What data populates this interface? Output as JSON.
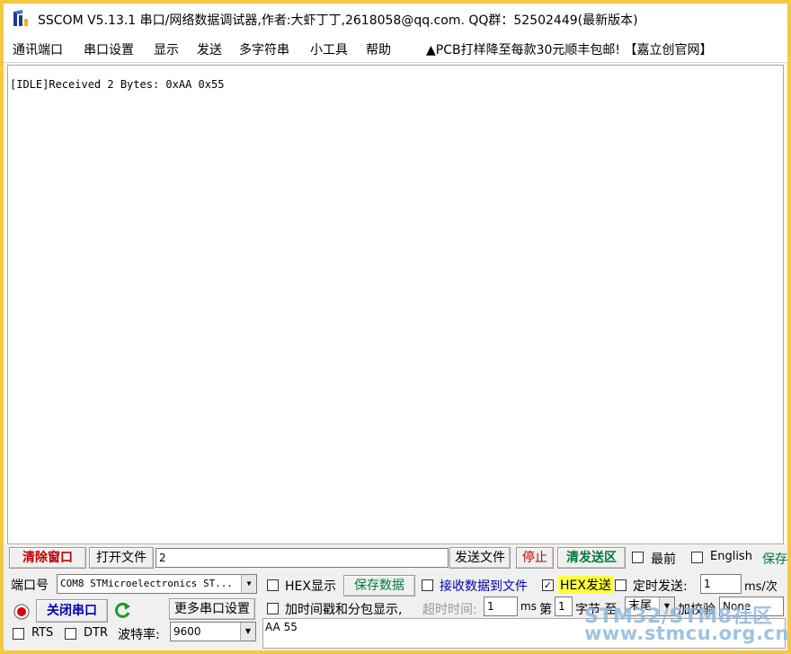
{
  "window": {
    "title": "SSCOM V5.13.1 串口/网络数据调试器,作者:大虾丁丁,2618058@qq.com. QQ群：52502449(最新版本)",
    "app_icon": "sscom-logo-icon",
    "frame_color": "#f5c842"
  },
  "menu": {
    "items": [
      "通讯端口",
      "串口设置",
      "显示",
      "发送",
      "多字符串",
      "小工具",
      "帮助"
    ],
    "ad": "▲PCB打样降至每款30元顺丰包邮! 【嘉立创官网】"
  },
  "output": {
    "lines": [
      "[IDLE]Received 2 Bytes: 0xAA 0x55"
    ]
  },
  "row1": {
    "clear_button": "清除窗口",
    "open_file_button": "打开文件",
    "file_path": "2",
    "send_file_button": "发送文件",
    "stop_button": "停止",
    "clear_send_button": "清发送区",
    "topmost_label": "最前",
    "english_label": "English",
    "save_label": "保存"
  },
  "row2": {
    "port_label": "端口号",
    "port_value": "COM8 STMicroelectronics ST...",
    "hex_display_label": "HEX显示",
    "save_data_button": "保存数据",
    "recv_to_file_label": "接收数据到文件",
    "hex_send_label": "HEX发送",
    "timed_send_label": "定时发送:",
    "interval_value": "1",
    "interval_unit": "ms/次"
  },
  "row3": {
    "close_port_button": "关闭串口",
    "refresh_icon": "refresh-icon",
    "more_settings_button": "更多串口设置",
    "timestamp_label": "加时间戳和分包显示,",
    "timeout_label": "超时时间:",
    "timeout_value": "1",
    "timeout_unit": "ms",
    "byte_prefix": "第",
    "byte_value": "1",
    "byte_suffix": "字节 至",
    "end_value": "末尾",
    "checksum_label": "加校验",
    "checksum_value": "None"
  },
  "row4": {
    "rts_label": "RTS",
    "dtr_label": "DTR",
    "baud_label": "波特率:",
    "baud_value": "9600",
    "send_text": "AA 55"
  },
  "watermark": {
    "line1": "STM32/STM8社区",
    "line2": "www.stmcu.org.cn"
  }
}
